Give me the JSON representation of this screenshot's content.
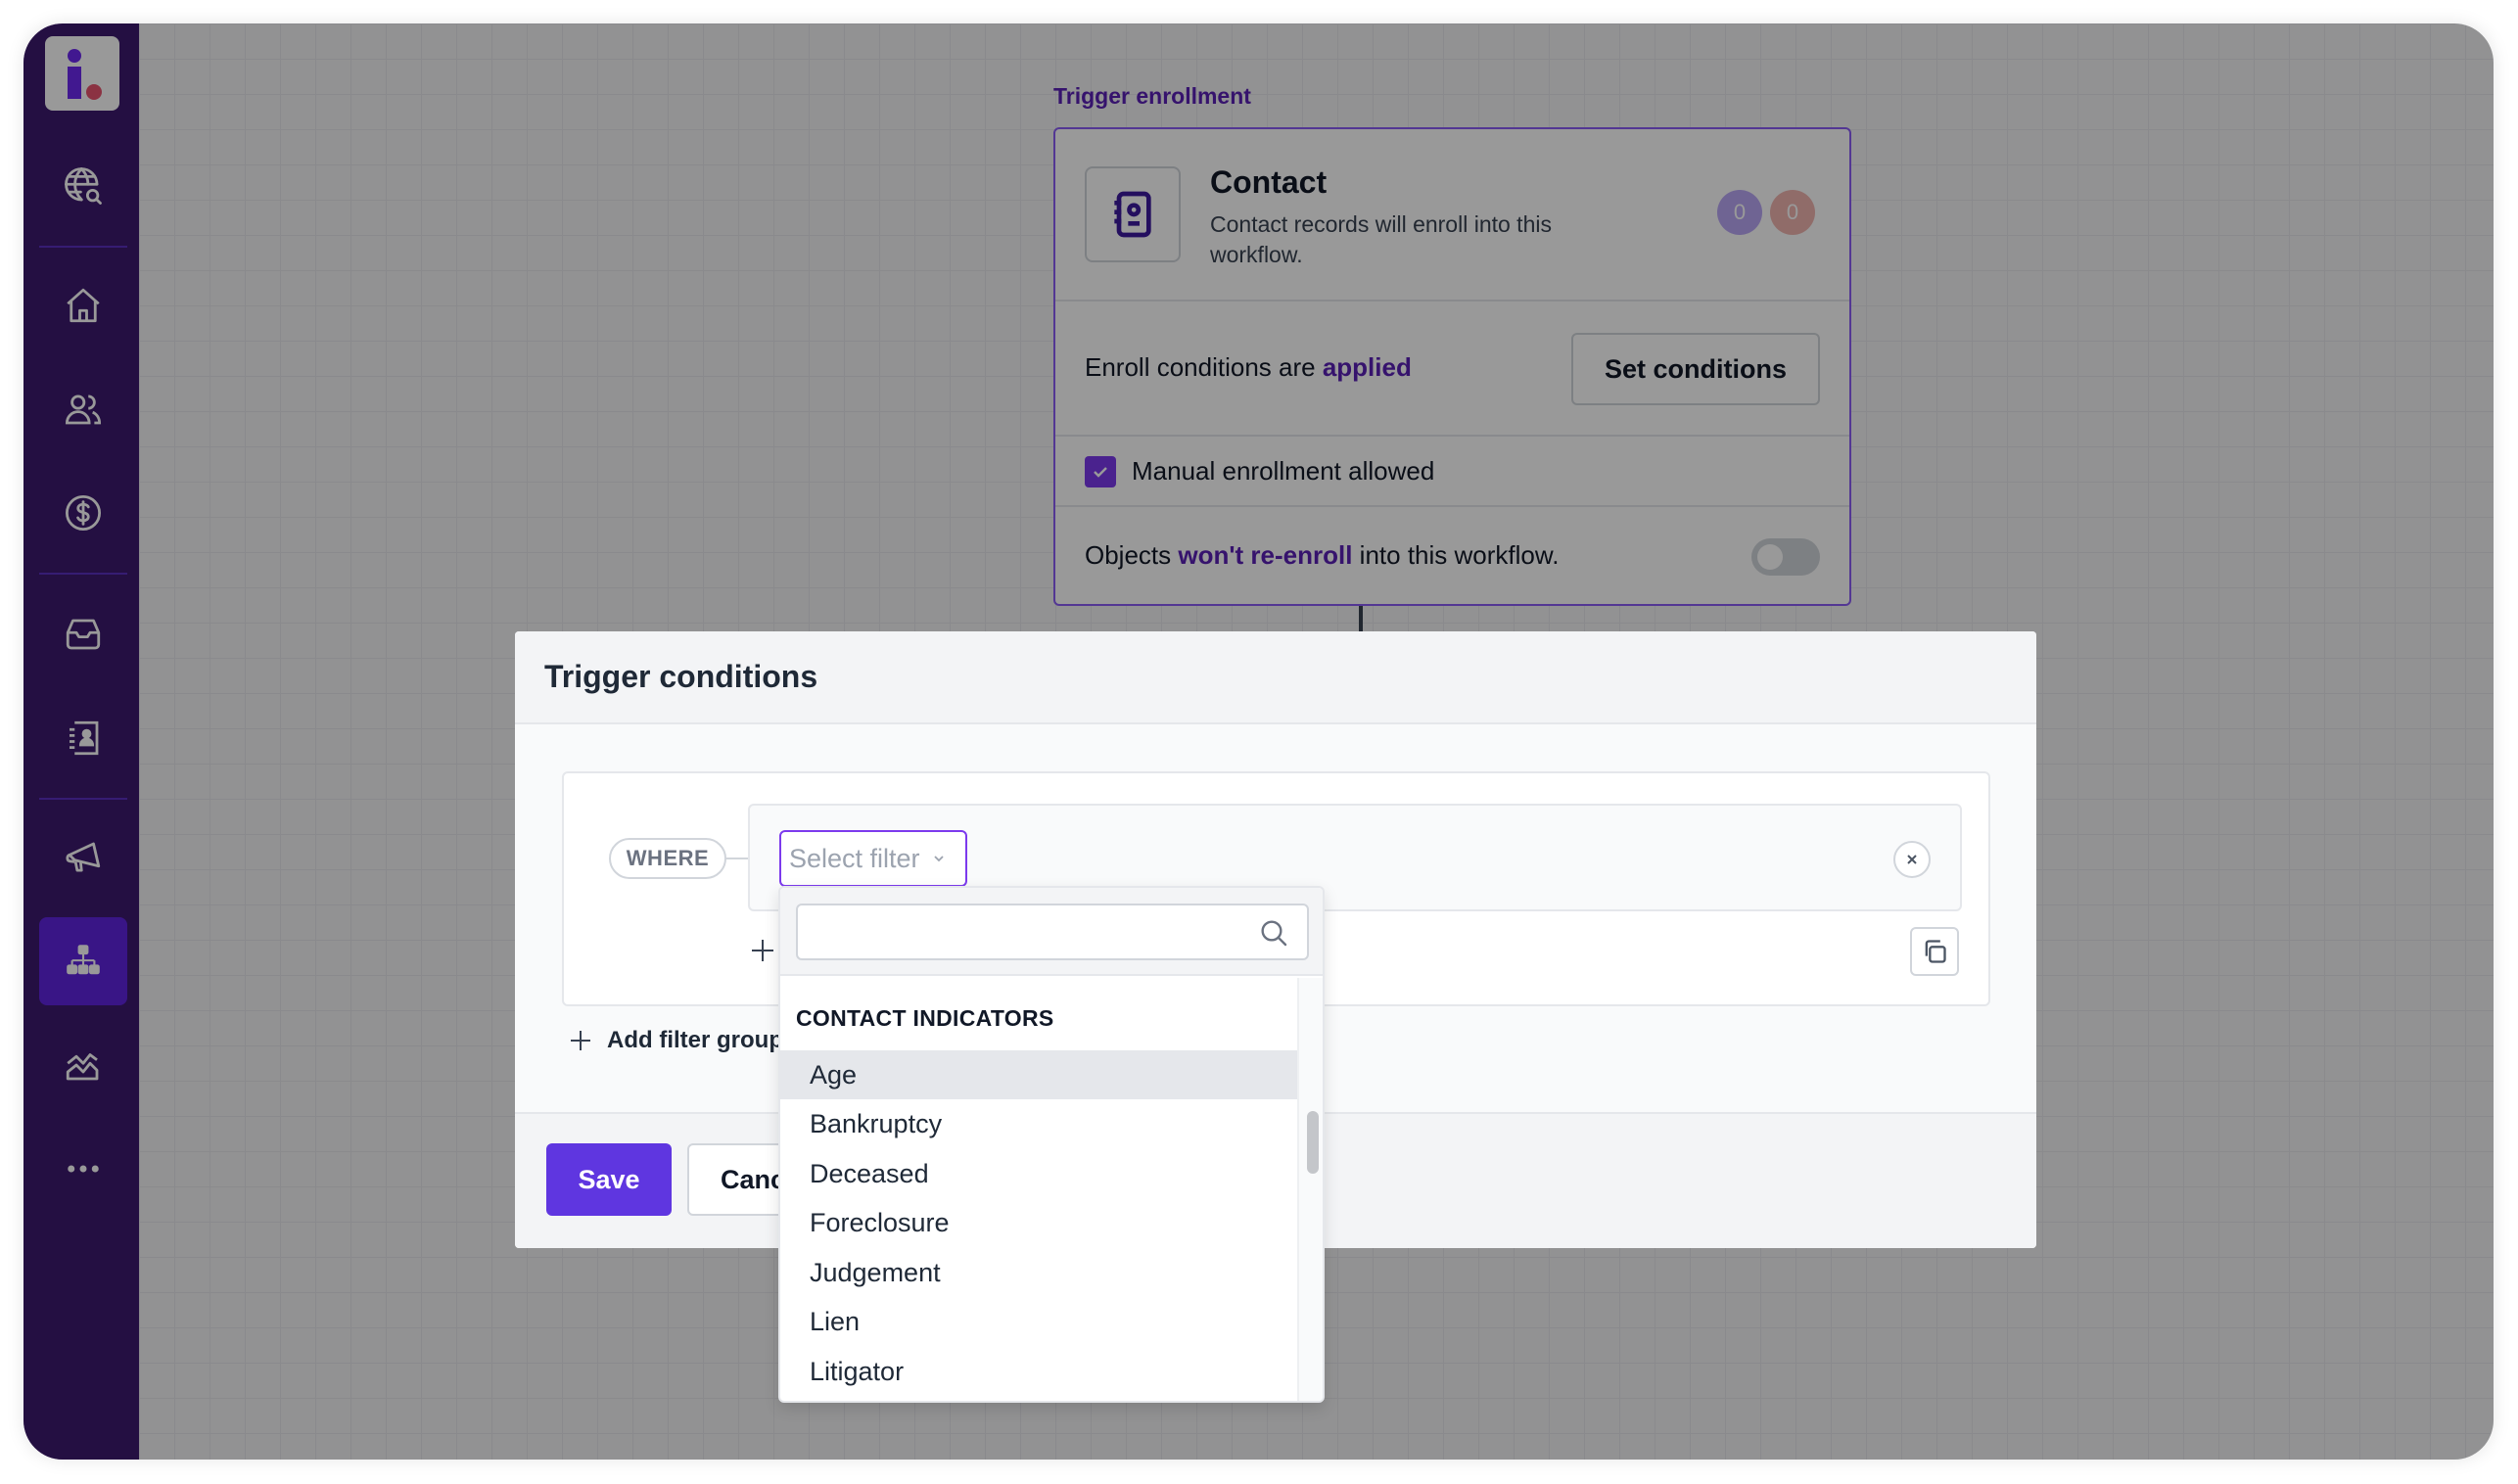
{
  "sidebar": {
    "items": [
      {
        "id": "global-search",
        "icon": "globe-search-icon"
      },
      {
        "id": "home",
        "icon": "home-icon"
      },
      {
        "id": "contacts",
        "icon": "users-icon"
      },
      {
        "id": "deals",
        "icon": "dollar-icon"
      },
      {
        "id": "inbox",
        "icon": "inbox-icon"
      },
      {
        "id": "address-book",
        "icon": "contact-card-icon"
      },
      {
        "id": "campaigns",
        "icon": "megaphone-icon"
      },
      {
        "id": "workflows",
        "icon": "workflow-icon",
        "active": true
      },
      {
        "id": "analytics",
        "icon": "analytics-icon"
      },
      {
        "id": "more",
        "icon": "more-icon"
      }
    ],
    "brand_colors": {
      "background": "#3d1a6e",
      "active": "#6024e0",
      "logo_i": "#6d28f0",
      "logo_dot": "#e8546f"
    }
  },
  "canvas": {
    "trigger_label": "Trigger enrollment",
    "card": {
      "title": "Contact",
      "description": "Contact records will enroll into this workflow.",
      "badges": [
        "0",
        "0"
      ],
      "enroll_prefix": "Enroll conditions are ",
      "enroll_status": "applied",
      "set_conditions_label": "Set conditions",
      "manual_enrollment_label": "Manual enrollment allowed",
      "manual_enrollment_checked": true,
      "reenroll_prefix": "Objects ",
      "reenroll_emphasis": "won't re-enroll",
      "reenroll_suffix": " into this workflow.",
      "reenroll_toggle_on": false
    }
  },
  "modal": {
    "title": "Trigger conditions",
    "where_label": "WHERE",
    "select_filter_placeholder": "Select filter",
    "add_filter_group_label": "Add filter group",
    "save_label": "Save",
    "cancel_label": "Cancel"
  },
  "dropdown": {
    "search_value": "",
    "search_placeholder": "",
    "section_heading": "CONTACT INDICATORS",
    "items": [
      "Age",
      "Bankruptcy",
      "Deceased",
      "Foreclosure",
      "Judgement",
      "Lien",
      "Litigator"
    ],
    "hovered_index": 0
  },
  "colors": {
    "accent": "#5f36e0",
    "link": "#5b21b6",
    "focus_border": "#7c3aed"
  }
}
